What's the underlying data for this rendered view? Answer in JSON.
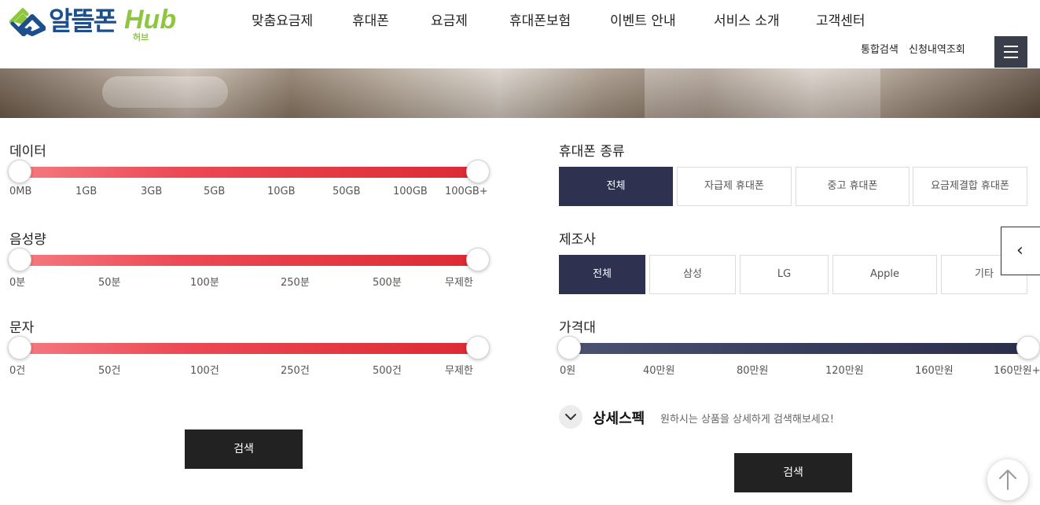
{
  "logo": {
    "name": "알뜰폰",
    "hub": "Hub",
    "sub": "허브"
  },
  "nav": [
    "맞춤요금제",
    "휴대폰",
    "요금제",
    "휴대폰보험",
    "이벤트 안내",
    "서비스 소개",
    "고객센터"
  ],
  "util": {
    "search": "통합검색",
    "order": "신청내역조회"
  },
  "left": {
    "data": {
      "label": "데이터",
      "ticks": [
        "0MB",
        "1GB",
        "3GB",
        "5GB",
        "10GB",
        "50GB",
        "100GB",
        "100GB+"
      ],
      "range": [
        "0MB",
        "100GB+"
      ]
    },
    "voice": {
      "label": "음성량",
      "ticks": [
        "0분",
        "50분",
        "100분",
        "250분",
        "500분",
        "무제한"
      ],
      "range": [
        "0분",
        "무제한"
      ]
    },
    "sms": {
      "label": "문자",
      "ticks": [
        "0건",
        "50건",
        "100건",
        "250건",
        "500건",
        "무제한"
      ],
      "range": [
        "0건",
        "무제한"
      ]
    },
    "search_label": "검색"
  },
  "right": {
    "phone_type": {
      "label": "휴대폰 종류",
      "options": [
        "전체",
        "자급제 휴대폰",
        "중고 휴대폰",
        "요금제결합 휴대폰"
      ],
      "selected": "전체"
    },
    "maker": {
      "label": "제조사",
      "options": [
        "전체",
        "삼성",
        "LG",
        "Apple",
        "기타"
      ],
      "selected": "전체"
    },
    "price": {
      "label": "가격대",
      "ticks": [
        "0원",
        "40만원",
        "80만원",
        "120만원",
        "160만원",
        "160만원+"
      ],
      "range": [
        "0원",
        "160만원+"
      ]
    },
    "spec": {
      "title": "상세스펙",
      "desc": "원하시는 상품을 상세하게 검색해보세요!"
    },
    "search_label": "검색"
  },
  "colors": {
    "accent_red": "#dc2a32",
    "navy": "#2e3150",
    "brand_blue": "#1c4f8c",
    "brand_green": "#8dc63f"
  }
}
